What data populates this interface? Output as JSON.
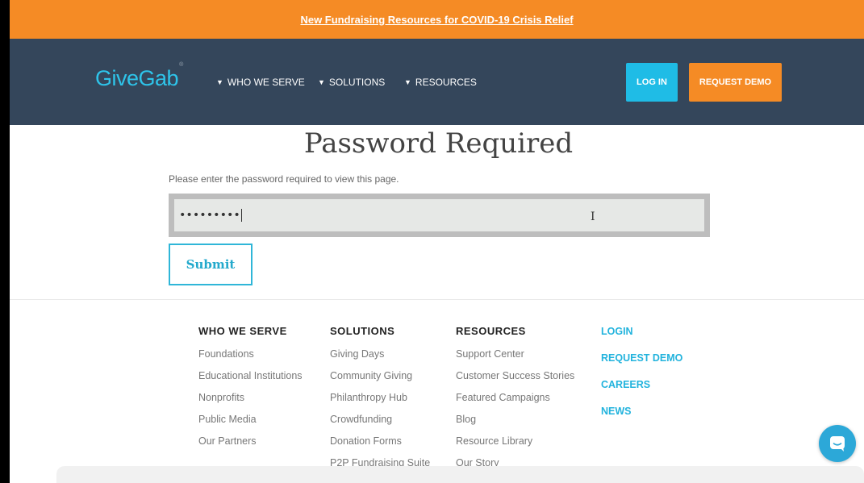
{
  "promo": {
    "text": "New Fundraising Resources for COVID-19 Crisis Relief"
  },
  "nav": {
    "logo": "GiveGab",
    "logo_mark": "®",
    "links": [
      {
        "label": "WHO WE SERVE"
      },
      {
        "label": "SOLUTIONS"
      },
      {
        "label": "RESOURCES"
      }
    ],
    "caret": "▼",
    "login": "LOG IN",
    "request_demo": "REQUEST DEMO"
  },
  "form": {
    "title": "Password Required",
    "instructions": "Please enter the password required to view this page.",
    "password_value": "•••••••••",
    "submit": "Submit"
  },
  "footer": {
    "who_we_serve": {
      "heading": "WHO WE SERVE",
      "items": [
        "Foundations",
        "Educational Institutions",
        "Nonprofits",
        "Public Media",
        "Our Partners"
      ]
    },
    "solutions": {
      "heading": "SOLUTIONS",
      "items": [
        "Giving Days",
        "Community Giving",
        "Philanthropy Hub",
        "Crowdfunding",
        "Donation Forms",
        "P2P Fundraising Suite"
      ]
    },
    "resources": {
      "heading": "RESOURCES",
      "items": [
        "Support Center",
        "Customer Success Stories",
        "Featured Campaigns",
        "Blog",
        "Resource Library",
        "Our Story"
      ]
    },
    "links": [
      "LOGIN",
      "REQUEST DEMO",
      "CAREERS",
      "NEWS"
    ]
  },
  "colors": {
    "accent_orange": "#f58b25",
    "nav_bg": "#34465b",
    "accent_blue": "#1fbce6"
  },
  "icons": {
    "chat": "chat-bubble-icon",
    "cursor": "text-cursor-icon"
  }
}
